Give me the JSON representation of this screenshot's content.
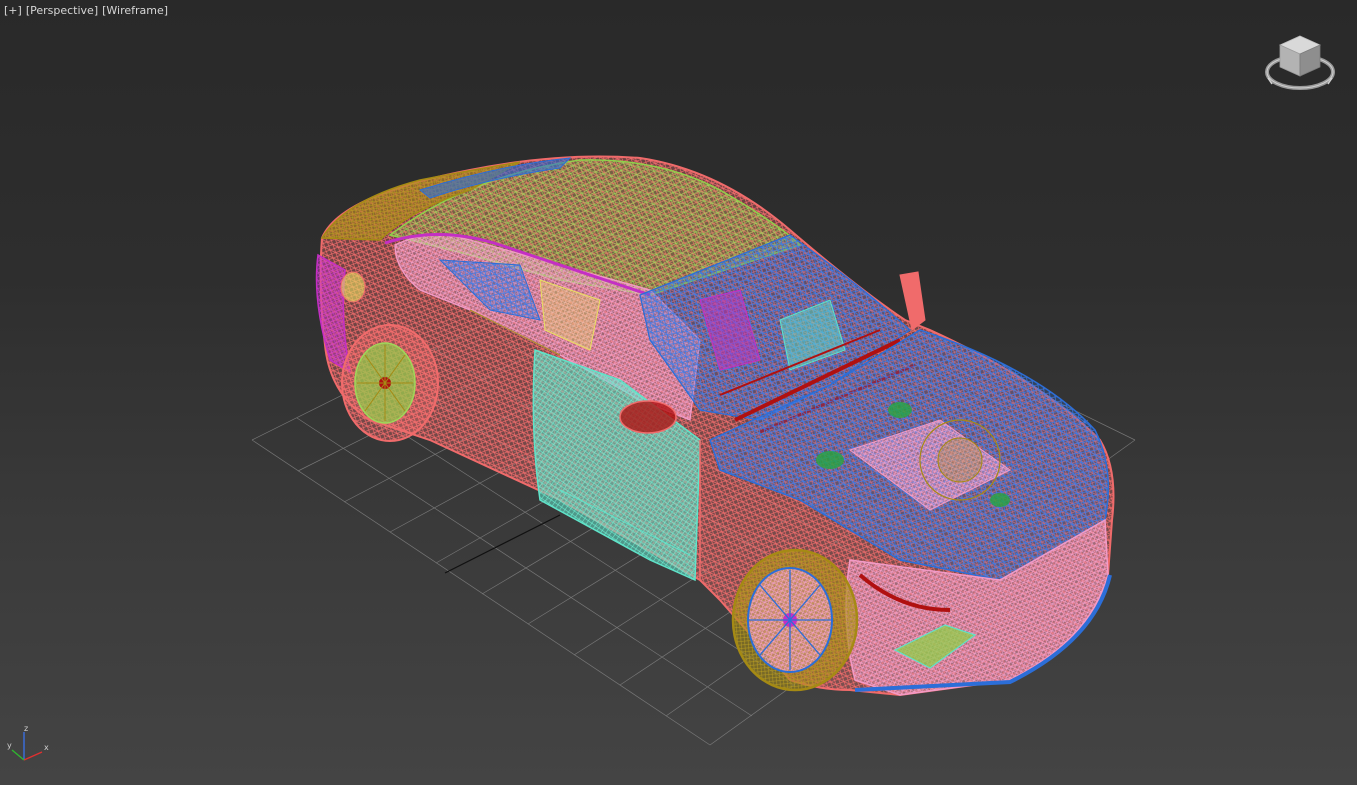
{
  "viewport": {
    "labels": [
      {
        "text": "+"
      },
      {
        "text": "Perspective"
      },
      {
        "text": "Wireframe"
      }
    ]
  },
  "viewcube": {
    "icon": "viewcube-icon",
    "faces": [
      "top",
      "front",
      "right"
    ]
  },
  "axis_tripod": {
    "icon": "axis-tripod-icon",
    "x_label": "x",
    "y_label": "y",
    "z_label": "z",
    "x_color": "#e03030",
    "y_color": "#2fb52f",
    "z_color": "#3a6fe0"
  },
  "scene": {
    "grid_color": "#8a8a8a",
    "wire_colors": [
      "#f06b6b",
      "#f29ac6",
      "#2c6ed8",
      "#8fd04a",
      "#5fe3c9",
      "#a58a14",
      "#c42fc4",
      "#b01010",
      "#e8e060",
      "#26a640"
    ]
  }
}
